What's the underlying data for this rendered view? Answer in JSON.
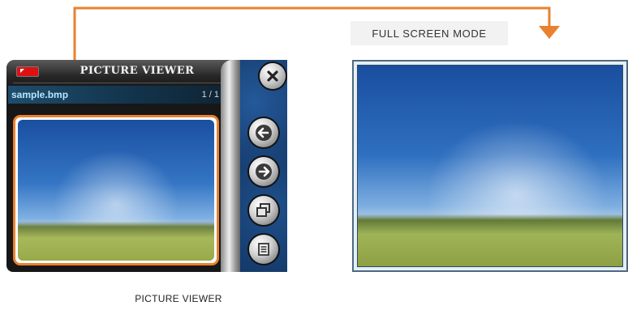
{
  "header": {
    "mode_label": "FULL SCREEN MODE"
  },
  "viewer": {
    "title": "PICTURE VIEWER",
    "file_name": "sample.bmp",
    "page_indicator": "1 / 1",
    "buttons": {
      "close": "close-icon",
      "previous": "arrow-left-icon",
      "next": "arrow-right-icon",
      "full_screen": "windows-icon",
      "menu": "list-icon"
    }
  },
  "captions": {
    "viewer": "PICTURE VIEWER"
  },
  "colors": {
    "accent": "#e9812f",
    "panel_blue": "#153a6a",
    "device_black": "#171717"
  }
}
